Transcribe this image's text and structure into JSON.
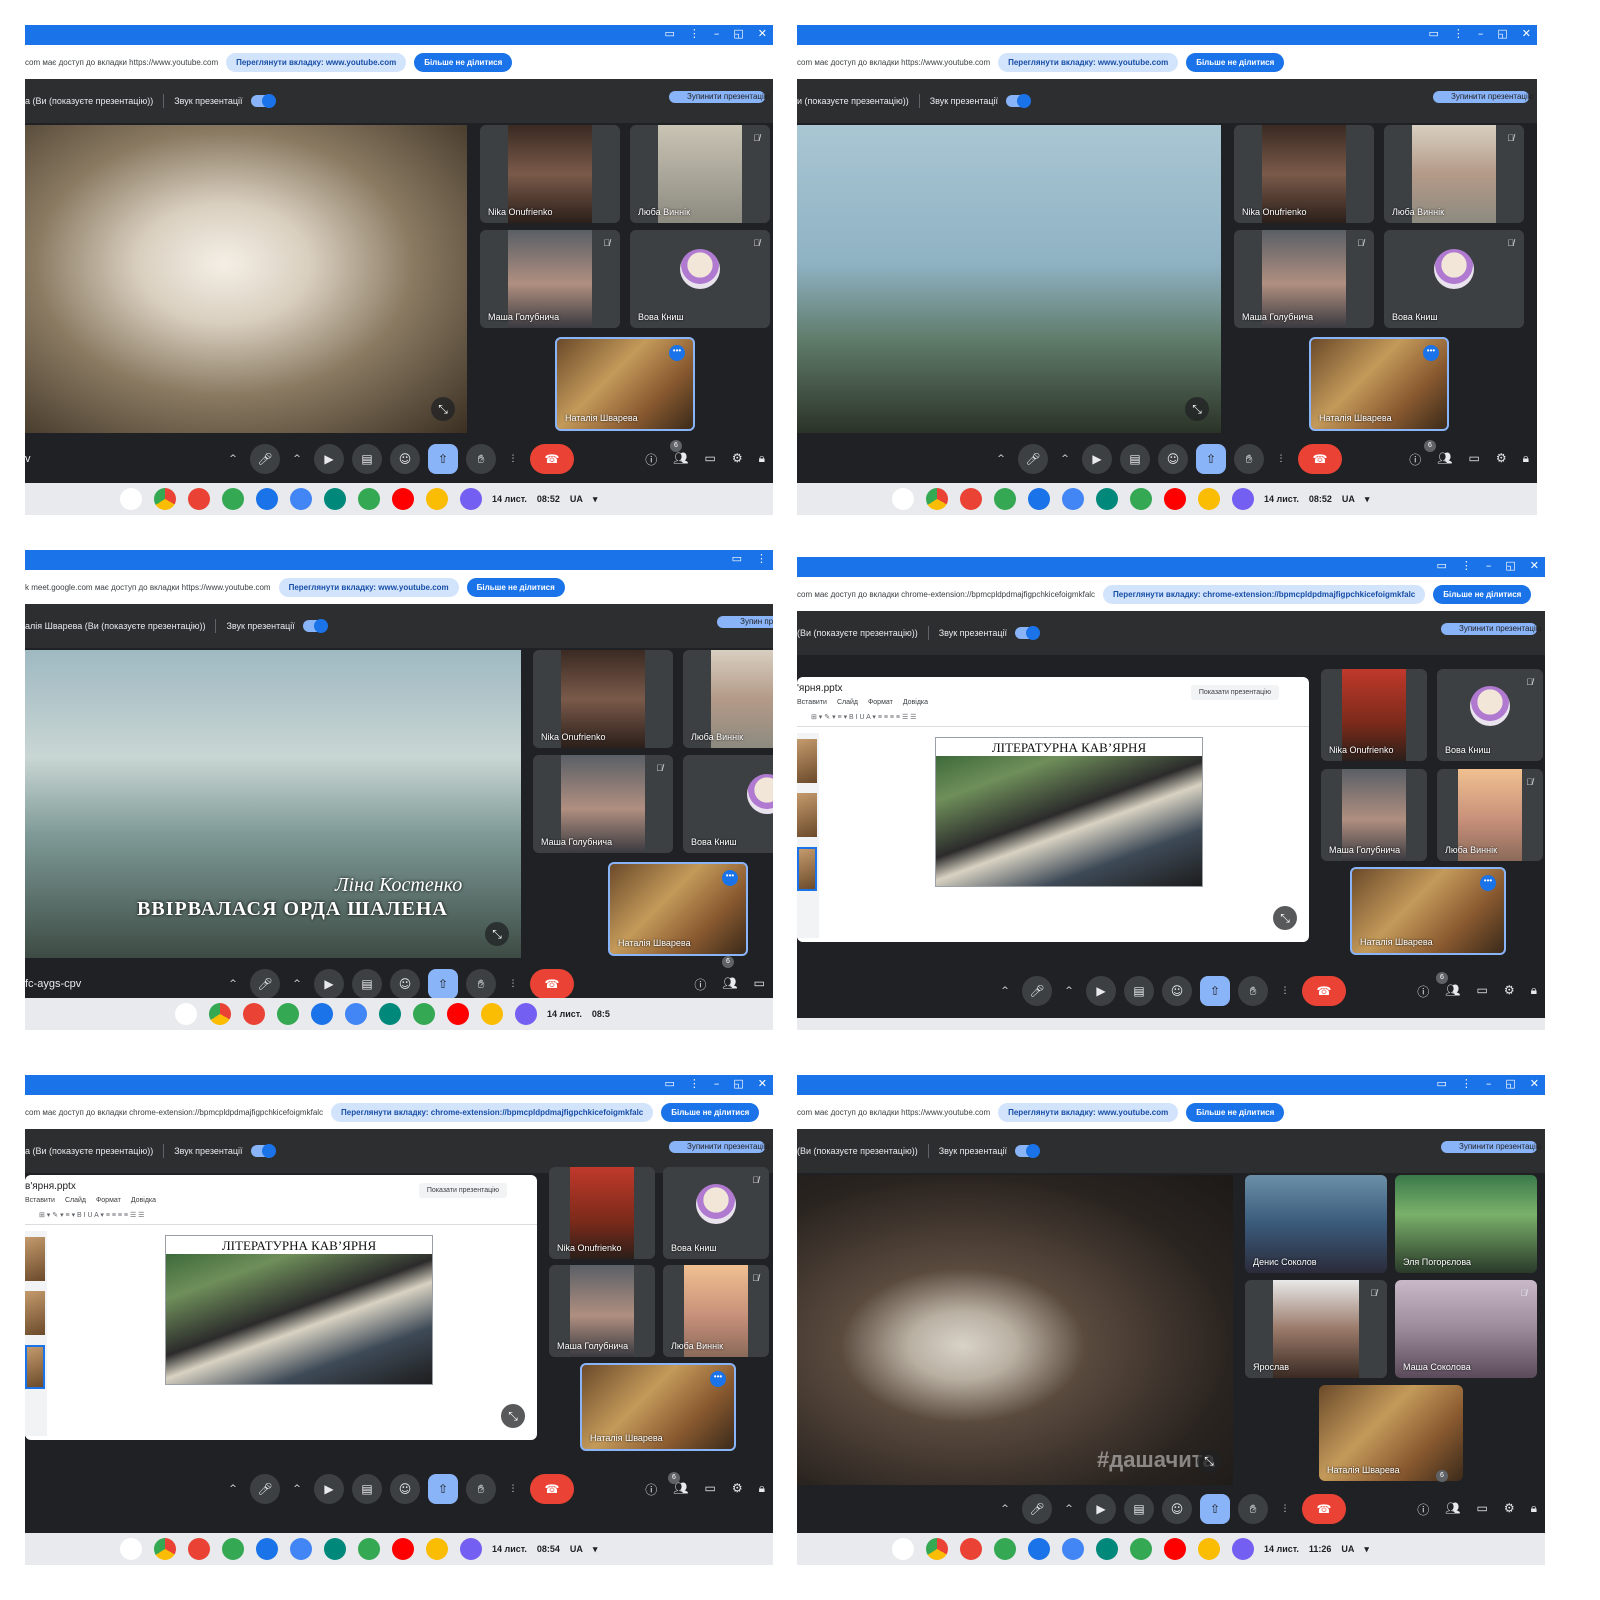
{
  "panels": [
    {
      "share_text": "com має доступ до вкладки https://www.youtube.com",
      "share_view_btn": "Переглянути вкладку: www.youtube.com",
      "share_stop_btn": "Більше не ділитися",
      "presenting_text": "а (Ви (показуєте презентацію))",
      "sound_label": "Звук презентації",
      "stop_pres_btn": "Зупинити презентацію",
      "tiles": [
        "Nika Onufrienko",
        "Люба Виннік",
        "Маша Голубнича",
        "Вова Книш",
        "Наталія Шварева"
      ],
      "participants_badge": "6",
      "meeting_code": "v",
      "date": "14 лист.",
      "time": "08:52",
      "region": "UA"
    },
    {
      "share_text": "com має доступ до вкладки https://www.youtube.com",
      "share_view_btn": "Переглянути вкладку: www.youtube.com",
      "share_stop_btn": "Більше не ділитися",
      "presenting_text": "и (показуєте презентацію))",
      "sound_label": "Звук презентації",
      "stop_pres_btn": "Зупинити презентацію",
      "tiles": [
        "Nika Onufrienko",
        "Люба Виннік",
        "Маша Голубнича",
        "Вова Книш",
        "Наталія Шварева"
      ],
      "participants_badge": "6",
      "date": "14 лист.",
      "time": "08:52",
      "region": "UA"
    },
    {
      "share_text": "k meet.google.com має доступ до вкладки https://www.youtube.com",
      "share_view_btn": "Переглянути вкладку: www.youtube.com",
      "share_stop_btn": "Більше не ділитися",
      "presenting_text": "алія Шварева (Ви (показуєте презентацію))",
      "sound_label": "Звук презентації",
      "stop_pres_btn": "Зупин презен",
      "tiles": [
        "Nika Onufrienko",
        "Люба Виннік",
        "Маша Голубнича",
        "Вова Книш",
        "Наталія Шварева"
      ],
      "participants_badge": "6",
      "meeting_code": "fc-aygs-cpv",
      "overlay_author": "Ліна Костенко",
      "overlay_title": "ВВІРВАЛАСЯ ОРДА ШАЛЕНА",
      "date": "14 лист.",
      "time": "08:5"
    },
    {
      "share_text": "com має доступ до вкладки chrome-extension://bpmcpldpdmajfigpchkicefoigmkfalc",
      "share_view_btn": "Переглянути вкладку: chrome-extension://bpmcpldpdmajfigpchkicefoigmkfalc",
      "share_stop_btn": "Більше не ділитися",
      "presenting_text": "(Ви (показуєте презентацію))",
      "sound_label": "Звук презентації",
      "stop_pres_btn": "Зупинити презентацію",
      "doc_title": "'ярня.pptx",
      "doc_menu": [
        "Вставити",
        "Слайд",
        "Формат",
        "Довідка"
      ],
      "doc_show_btn": "Показати презентацію",
      "slide_title": "ЛІТЕРАТУРНА КАВ’ЯРНЯ",
      "tiles": [
        "Nika Onufrienko",
        "Вова Книш",
        "Маша Голубнича",
        "Люба Виннік",
        "Наталія Шварева"
      ],
      "participants_badge": "6"
    },
    {
      "share_text": "com має доступ до вкладки chrome-extension://bpmcpldpdmajfigpchkicefoigmkfalc",
      "share_view_btn": "Переглянути вкладку: chrome-extension://bpmcpldpdmajfigpchkicefoigmkfalc",
      "share_stop_btn": "Більше не ділитися",
      "presenting_text": "а (Ви (показуєте презентацію))",
      "sound_label": "Звук презентації",
      "stop_pres_btn": "Зупинити презентацію",
      "doc_title": "в'ярня.pptx",
      "doc_menu": [
        "Вставити",
        "Слайд",
        "Формат",
        "Довідка"
      ],
      "doc_show_btn": "Показати презентацію",
      "slide_title": "ЛІТЕРАТУРНА КАВ’ЯРНЯ",
      "tiles": [
        "Nika Onufrienko",
        "Вова Книш",
        "Маша Голубнича",
        "Люба Виннік",
        "Наталія Шварева"
      ],
      "participants_badge": "6",
      "date": "14 лист.",
      "time": "08:54",
      "region": "UA"
    },
    {
      "share_text": "com має доступ до вкладки https://www.youtube.com",
      "share_view_btn": "Переглянути вкладку: www.youtube.com",
      "share_stop_btn": "Більше не ділитися",
      "presenting_text": "(Ви (показуєте презентацію))",
      "sound_label": "Звук презентації",
      "stop_pres_btn": "Зупинити презентацію",
      "overlay_hashtag": "#дашачита",
      "tiles": [
        "Денис Соколов",
        "Эля Погорєлова",
        "Ярослав",
        "Маша Соколова",
        "Наталія Шварева"
      ],
      "participants_badge": "6",
      "date": "14 лист.",
      "time": "11:26",
      "region": "UA"
    }
  ],
  "icons": {
    "mic": "mic-icon",
    "cam": "camera-icon",
    "cc": "captions-icon",
    "emoji": "emoji-icon",
    "present": "present-icon",
    "hand": "raise-hand-icon",
    "more": "more-icon",
    "end": "end-call-icon",
    "info": "info-icon",
    "people": "people-icon",
    "chat": "chat-icon",
    "activities": "activities-icon",
    "lock": "lock-icon"
  },
  "colors": {
    "accent": "#1a73e8",
    "end_call": "#ea4335",
    "meet_bg": "#202124"
  }
}
